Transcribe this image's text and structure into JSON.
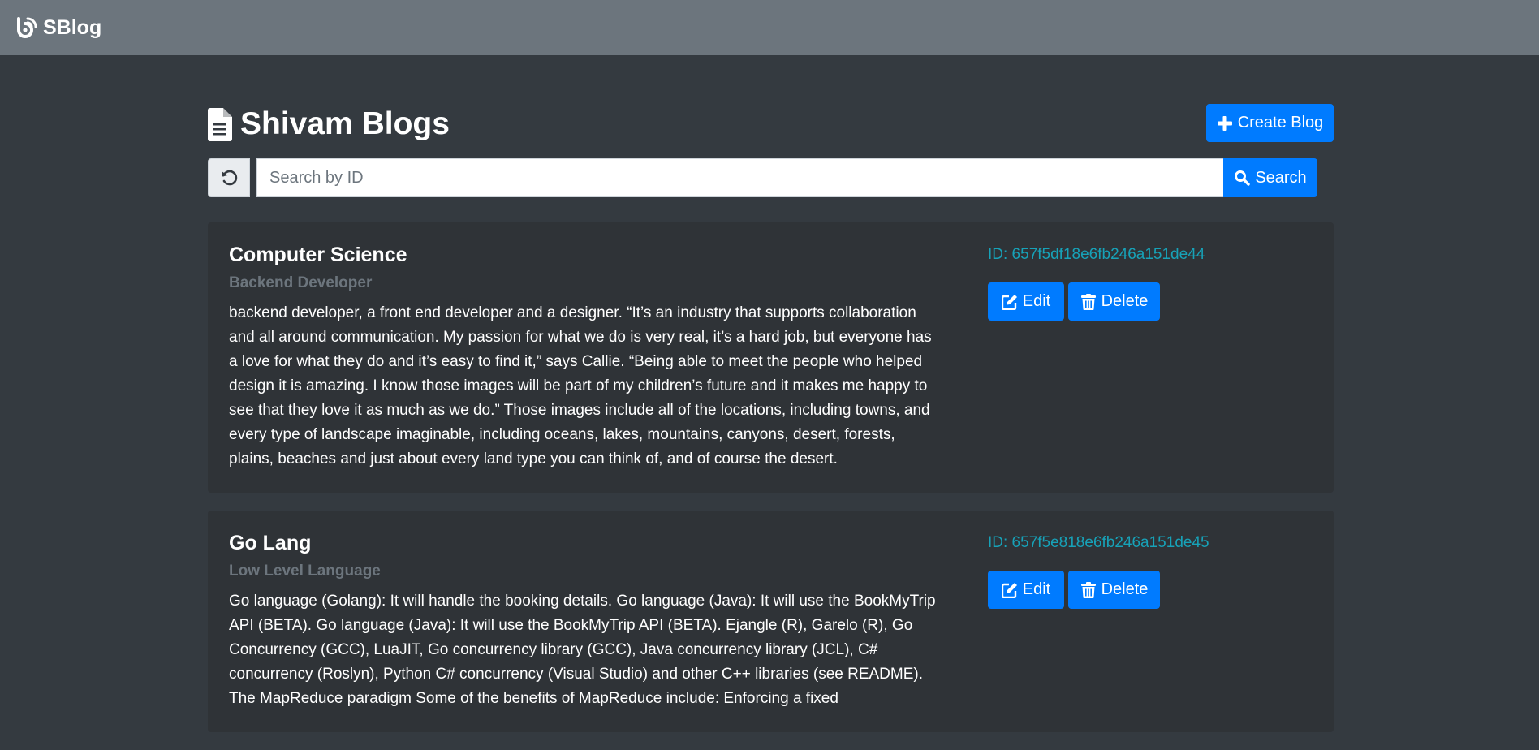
{
  "navbar": {
    "brand_label": "SBlog",
    "brand_icon": "blog-icon"
  },
  "header": {
    "title": "Shivam Blogs",
    "title_icon": "file-text-icon",
    "create_label": "Create Blog",
    "create_icon": "plus-icon"
  },
  "search": {
    "reset_icon": "undo-icon",
    "placeholder": "Search by ID",
    "value": "",
    "button_label": "Search",
    "button_icon": "search-icon"
  },
  "posts": [
    {
      "title": "Computer Science",
      "subtitle": "Backend Developer",
      "body": "backend developer, a front end developer and a designer. “It’s an industry that supports collaboration and all around communication. My passion for what we do is very real, it’s a hard job, but everyone has a love for what they do and it’s easy to find it,” says Callie. “Being able to meet the people who helped design it is amazing. I know those images will be part of my children’s future and it makes me happy to see that they love it as much as we do.” Those images include all of the locations, including towns, and every type of landscape imaginable, including oceans, lakes, mountains, canyons, desert, forests, plains, beaches and just about every land type you can think of, and of course the desert.",
      "id_text": "ID: 657f5df18e6fb246a151de44",
      "edit_label": "Edit",
      "delete_label": "Delete"
    },
    {
      "title": "Go Lang",
      "subtitle": "Low Level Language",
      "body": "Go language (Golang): It will handle the booking details. Go language (Java): It will use the BookMyTrip API (BETA). Go language (Java): It will use the BookMyTrip API (BETA). Ejangle (R), Garelo (R), Go Concurrency (GCC), LuaJIT, Go concurrency library (GCC), Java concurrency library (JCL), C# concurrency (Roslyn), Python C# concurrency (Visual Studio) and other C++ libraries (see README). The MapReduce paradigm Some of the benefits of MapReduce include: Enforcing a fixed",
      "id_text": "ID: 657f5e818e6fb246a151de45",
      "edit_label": "Edit",
      "delete_label": "Delete"
    }
  ],
  "colors": {
    "navbar_bg": "#6c757d",
    "page_bg": "#343a40",
    "card_bg": "#2f3337",
    "primary": "#007bff",
    "id_text": "#17a2b8",
    "muted": "#6c757d"
  }
}
